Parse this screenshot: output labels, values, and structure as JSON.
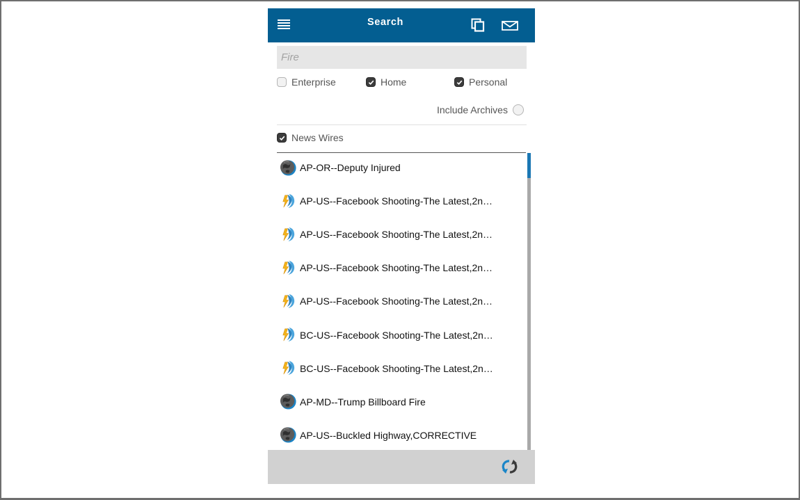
{
  "header": {
    "title": "Search",
    "menu_icon": "hamburger-menu-icon",
    "copy_icon": "copy-windows-icon",
    "mail_icon": "envelope-icon",
    "background": "#035e91"
  },
  "search": {
    "value": "",
    "placeholder": "Fire"
  },
  "filters": {
    "enterprise": {
      "label": "Enterprise",
      "checked": false
    },
    "home": {
      "label": "Home",
      "checked": true
    },
    "personal": {
      "label": "Personal",
      "checked": true
    },
    "include_archives": {
      "label": "Include Archives",
      "checked": false
    },
    "news_wires": {
      "label": "News Wires",
      "checked": true
    }
  },
  "results": [
    {
      "icon": "globe-icon",
      "title": "AP-OR--Deputy Injured"
    },
    {
      "icon": "breaking-news-icon",
      "title": "AP-US--Facebook Shooting-The Latest,2n…"
    },
    {
      "icon": "breaking-news-icon",
      "title": "AP-US--Facebook Shooting-The Latest,2n…"
    },
    {
      "icon": "breaking-news-icon",
      "title": "AP-US--Facebook Shooting-The Latest,2n…"
    },
    {
      "icon": "breaking-news-icon",
      "title": "AP-US--Facebook Shooting-The Latest,2n…"
    },
    {
      "icon": "breaking-news-icon",
      "title": "BC-US--Facebook Shooting-The Latest,2n…"
    },
    {
      "icon": "breaking-news-icon",
      "title": "BC-US--Facebook Shooting-The Latest,2n…"
    },
    {
      "icon": "globe-icon",
      "title": "AP-MD--Trump Billboard Fire"
    },
    {
      "icon": "globe-icon",
      "title": "AP-US--Buckled Highway,CORRECTIVE"
    }
  ],
  "footer": {
    "refresh_icon": "refresh-icon",
    "background": "#d1d1d1"
  },
  "colors": {
    "accent": "#035e91",
    "scroll_thumb": "#1b77b3",
    "checkbox_checked": "#3c3c3c"
  }
}
